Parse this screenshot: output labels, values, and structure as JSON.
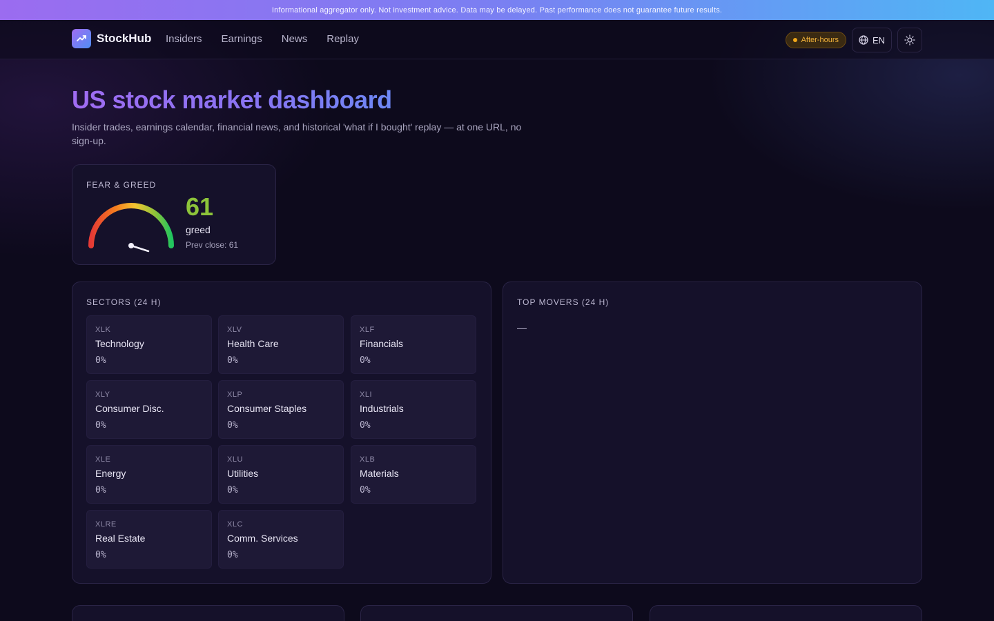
{
  "banner": {
    "text": "Informational aggregator only. Not investment advice. Data may be delayed. Past performance does not guarantee future results."
  },
  "header": {
    "brand": "StockHub",
    "nav": [
      "Insiders",
      "Earnings",
      "News",
      "Replay"
    ],
    "market_status": "After-hours",
    "language": "EN"
  },
  "hero": {
    "title": "US stock market dashboard",
    "subtitle": "Insider trades, earnings calendar, financial news, and historical 'what if I bought' replay — at one URL, no sign-up."
  },
  "fear_greed": {
    "label": "FEAR & GREED",
    "value": "61",
    "sentiment": "greed",
    "prev_close": "Prev close: 61"
  },
  "sectors": {
    "label": "SECTORS (24 H)",
    "items": [
      {
        "ticker": "XLK",
        "name": "Technology",
        "change": "0%"
      },
      {
        "ticker": "XLV",
        "name": "Health Care",
        "change": "0%"
      },
      {
        "ticker": "XLF",
        "name": "Financials",
        "change": "0%"
      },
      {
        "ticker": "XLY",
        "name": "Consumer Disc.",
        "change": "0%"
      },
      {
        "ticker": "XLP",
        "name": "Consumer Staples",
        "change": "0%"
      },
      {
        "ticker": "XLI",
        "name": "Industrials",
        "change": "0%"
      },
      {
        "ticker": "XLE",
        "name": "Energy",
        "change": "0%"
      },
      {
        "ticker": "XLU",
        "name": "Utilities",
        "change": "0%"
      },
      {
        "ticker": "XLB",
        "name": "Materials",
        "change": "0%"
      },
      {
        "ticker": "XLRE",
        "name": "Real Estate",
        "change": "0%"
      },
      {
        "ticker": "XLC",
        "name": "Comm. Services",
        "change": "0%"
      }
    ]
  },
  "top_movers": {
    "label": "TOP MOVERS (24 H)",
    "empty": "—"
  },
  "colors": {
    "accent": "#9b6cf0",
    "greed": "#8dc43a",
    "after_hours": "#f2b23a"
  }
}
